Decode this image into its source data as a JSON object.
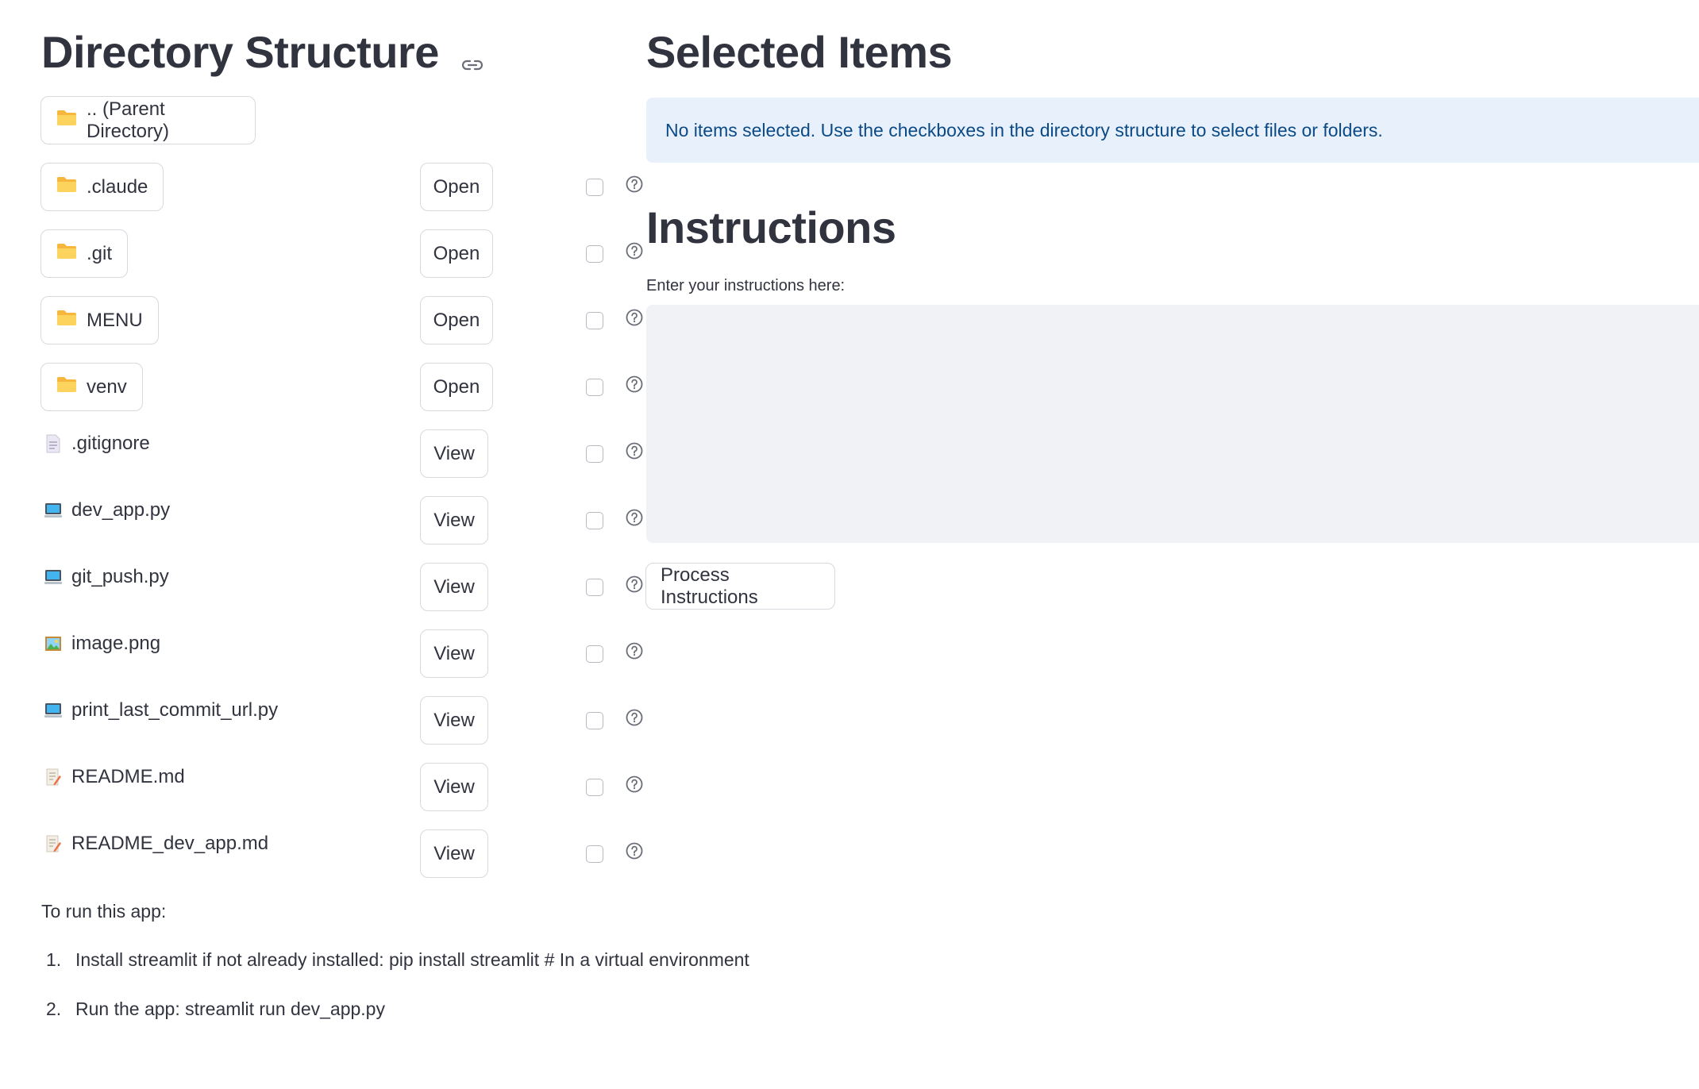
{
  "directory": {
    "title": "Directory Structure",
    "parent_label": ".. (Parent Directory)",
    "folders": [
      {
        "name": ".claude",
        "action": "Open"
      },
      {
        "name": ".git",
        "action": "Open"
      },
      {
        "name": "MENU",
        "action": "Open"
      },
      {
        "name": "venv",
        "action": "Open"
      }
    ],
    "files": [
      {
        "name": ".gitignore",
        "action": "View",
        "icon": "text-file-icon"
      },
      {
        "name": "dev_app.py",
        "action": "View",
        "icon": "computer-icon"
      },
      {
        "name": "git_push.py",
        "action": "View",
        "icon": "computer-icon"
      },
      {
        "name": "image.png",
        "action": "View",
        "icon": "picture-icon"
      },
      {
        "name": "print_last_commit_url.py",
        "action": "View",
        "icon": "computer-icon"
      },
      {
        "name": "README.md",
        "action": "View",
        "icon": "memo-icon"
      },
      {
        "name": "README_dev_app.md",
        "action": "View",
        "icon": "memo-icon"
      }
    ]
  },
  "selected": {
    "title": "Selected Items",
    "info": "No items selected. Use the checkboxes in the directory structure to select files or folders."
  },
  "instructions": {
    "title": "Instructions",
    "label": "Enter your instructions here:",
    "value": "",
    "button": "Process Instructions"
  },
  "footer": {
    "intro": "To run this app:",
    "steps": [
      {
        "num": "1.",
        "text": "Install streamlit if not already installed: pip install streamlit # In a virtual environment"
      },
      {
        "num": "2.",
        "text": "Run the app: streamlit run dev_app.py"
      }
    ]
  },
  "colors": {
    "info_bg": "#e8f1fb",
    "info_text": "#0b4a86",
    "textarea_bg": "#f0f2f6"
  }
}
